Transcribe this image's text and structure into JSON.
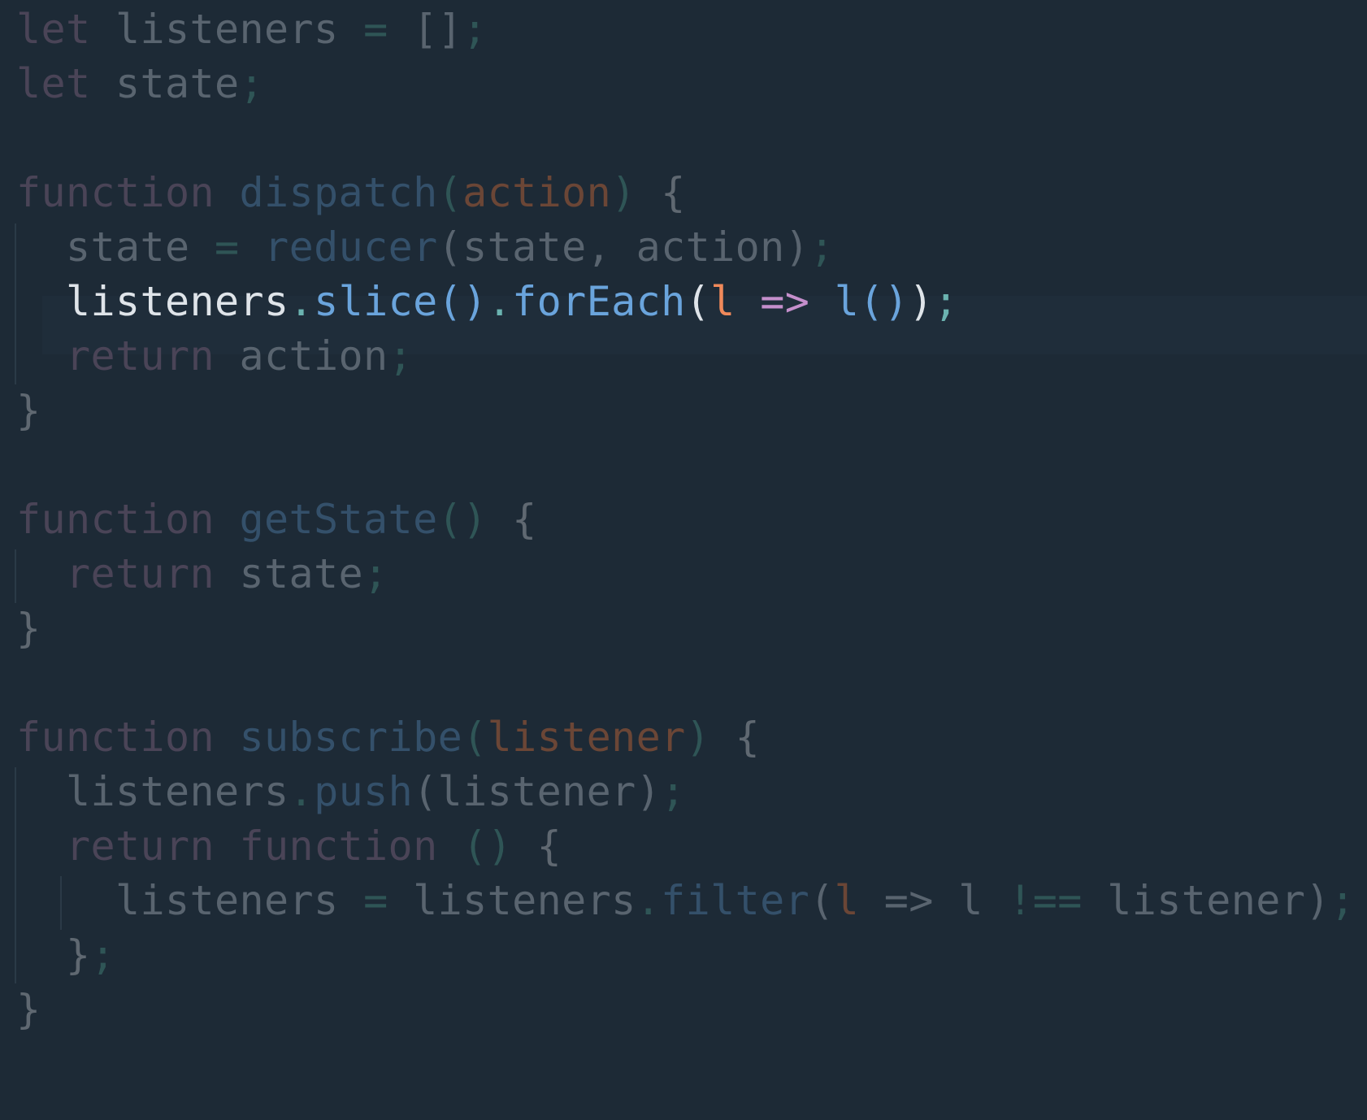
{
  "editor": {
    "language": "javascript",
    "highlighted_line": 6,
    "colors": {
      "background": "#1d2a36",
      "dim_text": "#59646f",
      "dim_keyword": "#4a4457",
      "dim_function": "#34506a",
      "dim_punctuation": "#2f5556",
      "dim_param": "#6b4636",
      "highlight_text": "#dfe4e9",
      "highlight_function": "#6aa4dc",
      "highlight_punctuation": "#6bb3b0",
      "highlight_param": "#f0895a",
      "highlight_arrow": "#c58fcc"
    },
    "lines": [
      [
        "let",
        " ",
        "listeners",
        " ",
        "=",
        " ",
        "[]",
        ";"
      ],
      [
        "let",
        " ",
        "state",
        ";"
      ],
      [],
      [
        "function",
        " ",
        "dispatch",
        "(",
        "action",
        ")",
        " ",
        "{"
      ],
      [
        "  ",
        "state",
        " ",
        "=",
        " ",
        "reducer",
        "(",
        "state, action",
        ")",
        ";"
      ],
      [
        "  ",
        "listeners",
        ".",
        "slice",
        "()",
        ".",
        "forEach",
        "(",
        "l",
        " ",
        "=>",
        " ",
        "l",
        "()",
        ")",
        ";"
      ],
      [
        "  ",
        "return",
        " ",
        "action",
        ";"
      ],
      [
        "}"
      ],
      [],
      [
        "function",
        " ",
        "getState",
        "()",
        " ",
        "{"
      ],
      [
        "  ",
        "return",
        " ",
        "state",
        ";"
      ],
      [
        "}"
      ],
      [],
      [
        "function",
        " ",
        "subscribe",
        "(",
        "listener",
        ")",
        " ",
        "{"
      ],
      [
        "  ",
        "listeners",
        ".",
        "push",
        "(",
        "listener",
        ")",
        ";"
      ],
      [
        "  ",
        "return",
        " ",
        "function",
        " ",
        "()",
        " ",
        "{"
      ],
      [
        "    ",
        "listeners",
        " ",
        "=",
        " ",
        "listeners",
        ".",
        "filter",
        "(",
        "l",
        " ",
        "=>",
        " ",
        "l",
        " ",
        "!==",
        " ",
        "listener",
        ")",
        ";"
      ],
      [
        "  ",
        "}",
        ";"
      ],
      [
        "}"
      ]
    ]
  }
}
